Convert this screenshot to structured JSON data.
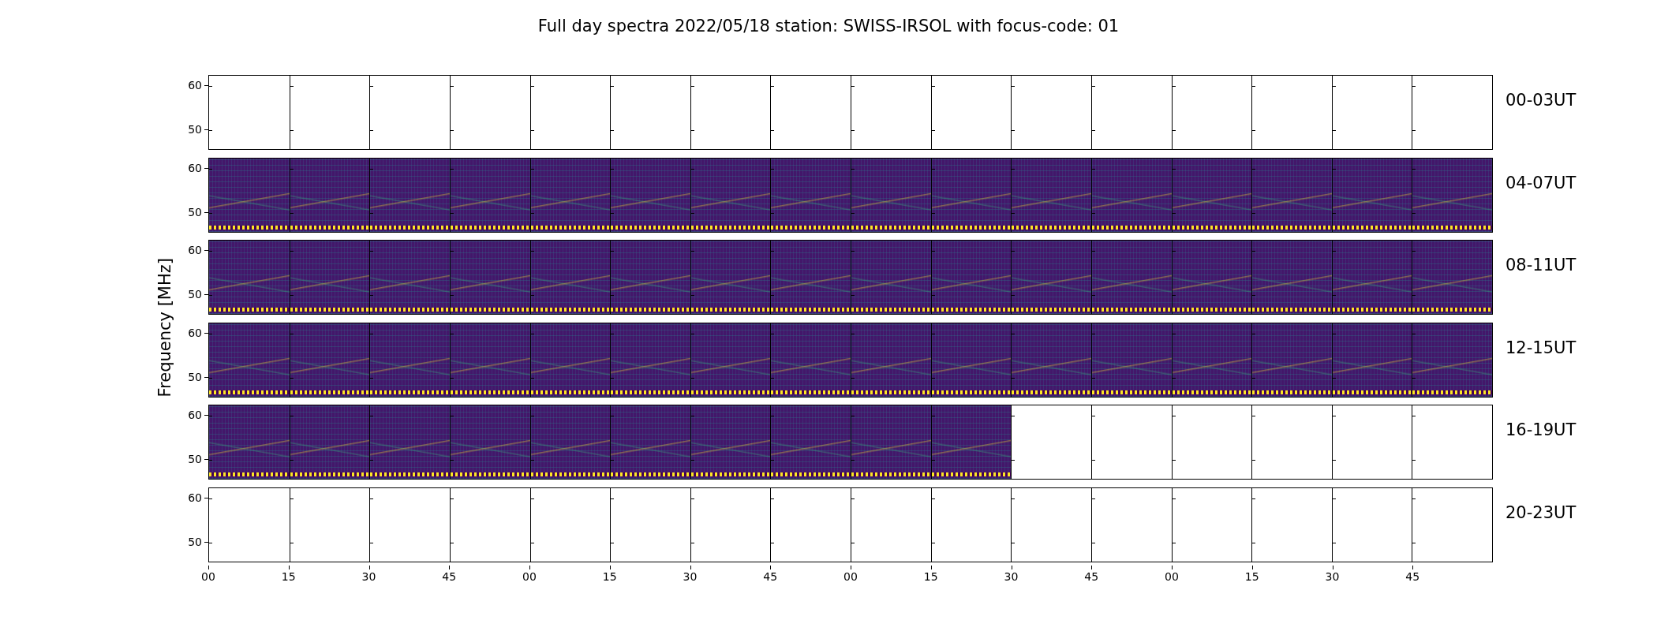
{
  "title": "Full day spectra 2022/05/18 station: SWISS-IRSOL with focus-code: 01",
  "y_axis_label": "Frequency [MHz]",
  "rows": [
    {
      "label": "00-03UT",
      "yticks": [
        "60",
        "50"
      ],
      "panels": [
        {
          "kind": "empty"
        },
        {
          "kind": "empty"
        },
        {
          "kind": "empty"
        },
        {
          "kind": "empty"
        },
        {
          "kind": "empty"
        },
        {
          "kind": "empty"
        },
        {
          "kind": "empty"
        },
        {
          "kind": "empty"
        },
        {
          "kind": "empty"
        },
        {
          "kind": "empty"
        },
        {
          "kind": "empty"
        },
        {
          "kind": "empty"
        },
        {
          "kind": "empty"
        },
        {
          "kind": "empty"
        },
        {
          "kind": "empty"
        },
        {
          "kind": "empty"
        }
      ]
    },
    {
      "label": "04-07UT",
      "yticks": [
        "60",
        "50"
      ],
      "panels": [
        {
          "kind": "spectrogram"
        },
        {
          "kind": "spectrogram"
        },
        {
          "kind": "spectrogram"
        },
        {
          "kind": "spectrogram"
        },
        {
          "kind": "spectrogram"
        },
        {
          "kind": "spectrogram"
        },
        {
          "kind": "spectrogram"
        },
        {
          "kind": "spectrogram"
        },
        {
          "kind": "spectrogram"
        },
        {
          "kind": "spectrogram"
        },
        {
          "kind": "spectrogram"
        },
        {
          "kind": "spectrogram"
        },
        {
          "kind": "spectrogram"
        },
        {
          "kind": "spectrogram"
        },
        {
          "kind": "spectrogram"
        },
        {
          "kind": "spectrogram"
        }
      ]
    },
    {
      "label": "08-11UT",
      "yticks": [
        "60",
        "50"
      ],
      "panels": [
        {
          "kind": "spectrogram"
        },
        {
          "kind": "spectrogram"
        },
        {
          "kind": "spectrogram"
        },
        {
          "kind": "spectrogram"
        },
        {
          "kind": "spectrogram"
        },
        {
          "kind": "spectrogram"
        },
        {
          "kind": "spectrogram"
        },
        {
          "kind": "spectrogram"
        },
        {
          "kind": "spectrogram"
        },
        {
          "kind": "spectrogram"
        },
        {
          "kind": "spectrogram"
        },
        {
          "kind": "spectrogram"
        },
        {
          "kind": "spectrogram"
        },
        {
          "kind": "spectrogram"
        },
        {
          "kind": "spectrogram"
        },
        {
          "kind": "spectrogram"
        }
      ]
    },
    {
      "label": "12-15UT",
      "yticks": [
        "60",
        "50"
      ],
      "panels": [
        {
          "kind": "spectrogram"
        },
        {
          "kind": "spectrogram"
        },
        {
          "kind": "spectrogram"
        },
        {
          "kind": "spectrogram"
        },
        {
          "kind": "spectrogram"
        },
        {
          "kind": "spectrogram"
        },
        {
          "kind": "spectrogram"
        },
        {
          "kind": "spectrogram"
        },
        {
          "kind": "spectrogram"
        },
        {
          "kind": "spectrogram"
        },
        {
          "kind": "spectrogram"
        },
        {
          "kind": "spectrogram"
        },
        {
          "kind": "spectrogram"
        },
        {
          "kind": "spectrogram"
        },
        {
          "kind": "spectrogram"
        },
        {
          "kind": "spectrogram"
        }
      ]
    },
    {
      "label": "16-19UT",
      "yticks": [
        "60",
        "50"
      ],
      "panels": [
        {
          "kind": "spectrogram"
        },
        {
          "kind": "spectrogram"
        },
        {
          "kind": "spectrogram"
        },
        {
          "kind": "spectrogram"
        },
        {
          "kind": "spectrogram"
        },
        {
          "kind": "spectrogram"
        },
        {
          "kind": "spectrogram"
        },
        {
          "kind": "spectrogram"
        },
        {
          "kind": "spectrogram"
        },
        {
          "kind": "spectrogram"
        },
        {
          "kind": "empty"
        },
        {
          "kind": "empty"
        },
        {
          "kind": "empty"
        },
        {
          "kind": "empty"
        },
        {
          "kind": "empty"
        },
        {
          "kind": "empty"
        }
      ]
    },
    {
      "label": "20-23UT",
      "yticks": [
        "60",
        "50"
      ],
      "panels": [
        {
          "kind": "empty"
        },
        {
          "kind": "empty"
        },
        {
          "kind": "empty"
        },
        {
          "kind": "empty"
        },
        {
          "kind": "empty"
        },
        {
          "kind": "empty"
        },
        {
          "kind": "empty"
        },
        {
          "kind": "empty"
        },
        {
          "kind": "empty"
        },
        {
          "kind": "empty"
        },
        {
          "kind": "empty"
        },
        {
          "kind": "empty"
        },
        {
          "kind": "empty"
        },
        {
          "kind": "empty"
        },
        {
          "kind": "empty"
        },
        {
          "kind": "empty"
        }
      ]
    }
  ],
  "x_tick_labels": [
    "00",
    "15",
    "30",
    "45",
    "00",
    "15",
    "30",
    "45",
    "00",
    "15",
    "30",
    "45",
    "00",
    "15",
    "30",
    "45"
  ]
}
